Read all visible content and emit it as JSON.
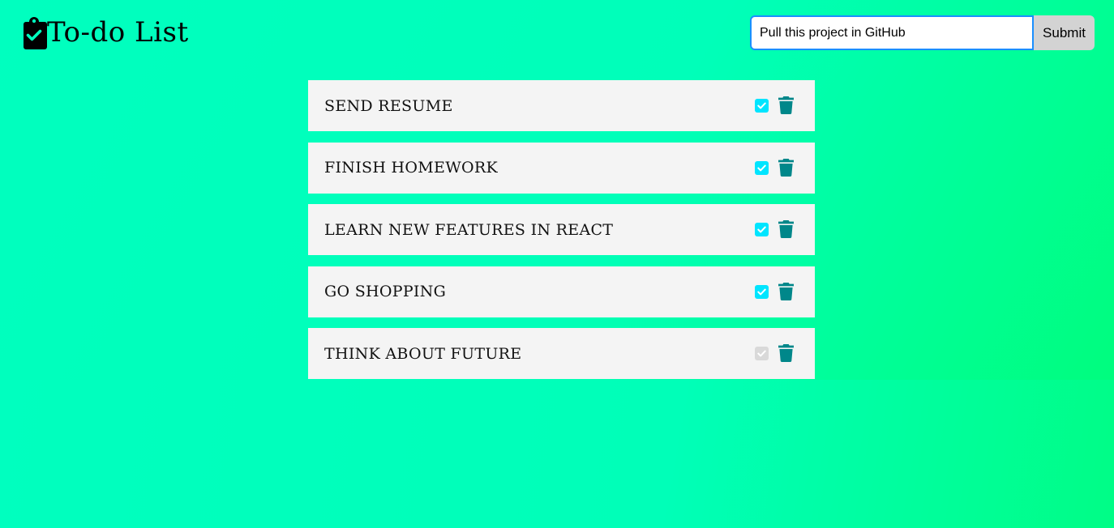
{
  "header": {
    "title": "To-do List",
    "logo_icon": "clipboard-check-icon"
  },
  "form": {
    "input_value": "Pull this project in GitHub",
    "submit_label": "Submit"
  },
  "todos": [
    {
      "text": "SEND RESUME",
      "completed": true
    },
    {
      "text": "FINISH HOMEWORK",
      "completed": true
    },
    {
      "text": "LEARN NEW FEATURES IN REACT",
      "completed": true
    },
    {
      "text": "GO SHOPPING",
      "completed": true
    },
    {
      "text": "THINK ABOUT FUTURE",
      "completed": false
    }
  ],
  "icons": {
    "check": "check-icon",
    "delete": "trash-icon"
  },
  "colors": {
    "background": "#00ffbe",
    "item_background": "#f4f4f4",
    "checkbox_checked": "#00e5ff",
    "checkbox_unchecked": "#d9d9d9",
    "trash": "#00878a",
    "input_border": "#1a8fff"
  }
}
